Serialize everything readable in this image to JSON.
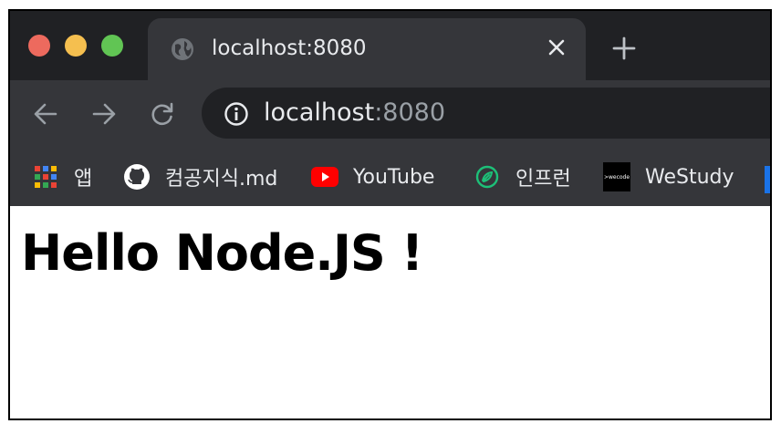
{
  "window": {
    "controls": {
      "close_color": "#ed6a5e",
      "minimize_color": "#f5bf4f",
      "maximize_color": "#61c554"
    }
  },
  "tab": {
    "title": "localhost:8080",
    "icon": "globe-icon",
    "close_icon": "close-icon"
  },
  "new_tab_icon": "plus-icon",
  "toolbar": {
    "back_icon": "arrow-left-icon",
    "forward_icon": "arrow-right-icon",
    "reload_icon": "reload-icon",
    "info_icon": "info-icon",
    "url_host": "localhost",
    "url_port": ":8080"
  },
  "bookmarks": [
    {
      "label": "앱",
      "icon": "apps-grid-icon"
    },
    {
      "label": "컴공지식.md",
      "icon": "github-icon"
    },
    {
      "label": "YouTube",
      "icon": "youtube-icon"
    },
    {
      "label": "인프런",
      "icon": "inflearn-icon"
    },
    {
      "label": "WeStudy",
      "icon": "wecode-icon",
      "icon_text": ">wecode"
    }
  ],
  "page": {
    "heading": "Hello Node.JS !"
  },
  "colors": {
    "tabbar_bg": "#202124",
    "toolbar_bg": "#35363a",
    "text_light": "#e8eaed",
    "text_muted": "#9aa0a6",
    "youtube_red": "#ff0000",
    "inflearn_green": "#1dc078"
  }
}
